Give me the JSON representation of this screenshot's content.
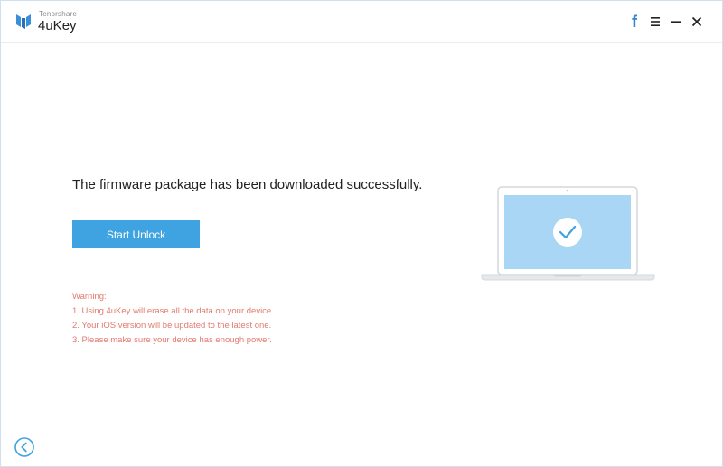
{
  "app": {
    "brand_small": "Tenorshare",
    "brand_name": "4uKey"
  },
  "window_controls": {
    "facebook_glyph": "f"
  },
  "main": {
    "headline": "The firmware package has been downloaded successfully.",
    "start_button_label": "Start Unlock",
    "warning": {
      "title": "Warning:",
      "items": [
        "1. Using 4uKey will erase all the data on your device.",
        "2. Your iOS version will be updated to the latest one.",
        "3. Please make sure your device has enough power."
      ]
    }
  },
  "icons": {
    "logo": "tenorshare-logo-icon",
    "facebook": "facebook-icon",
    "menu": "menu-icon",
    "minimize": "minimize-icon",
    "close": "close-icon",
    "laptop": "laptop-check-icon",
    "back": "back-arrow-icon"
  },
  "colors": {
    "accent": "#3ea3e0",
    "warning": "#e27a6f",
    "facebook": "#2f86d1",
    "laptop_screen": "#aad6f5"
  }
}
